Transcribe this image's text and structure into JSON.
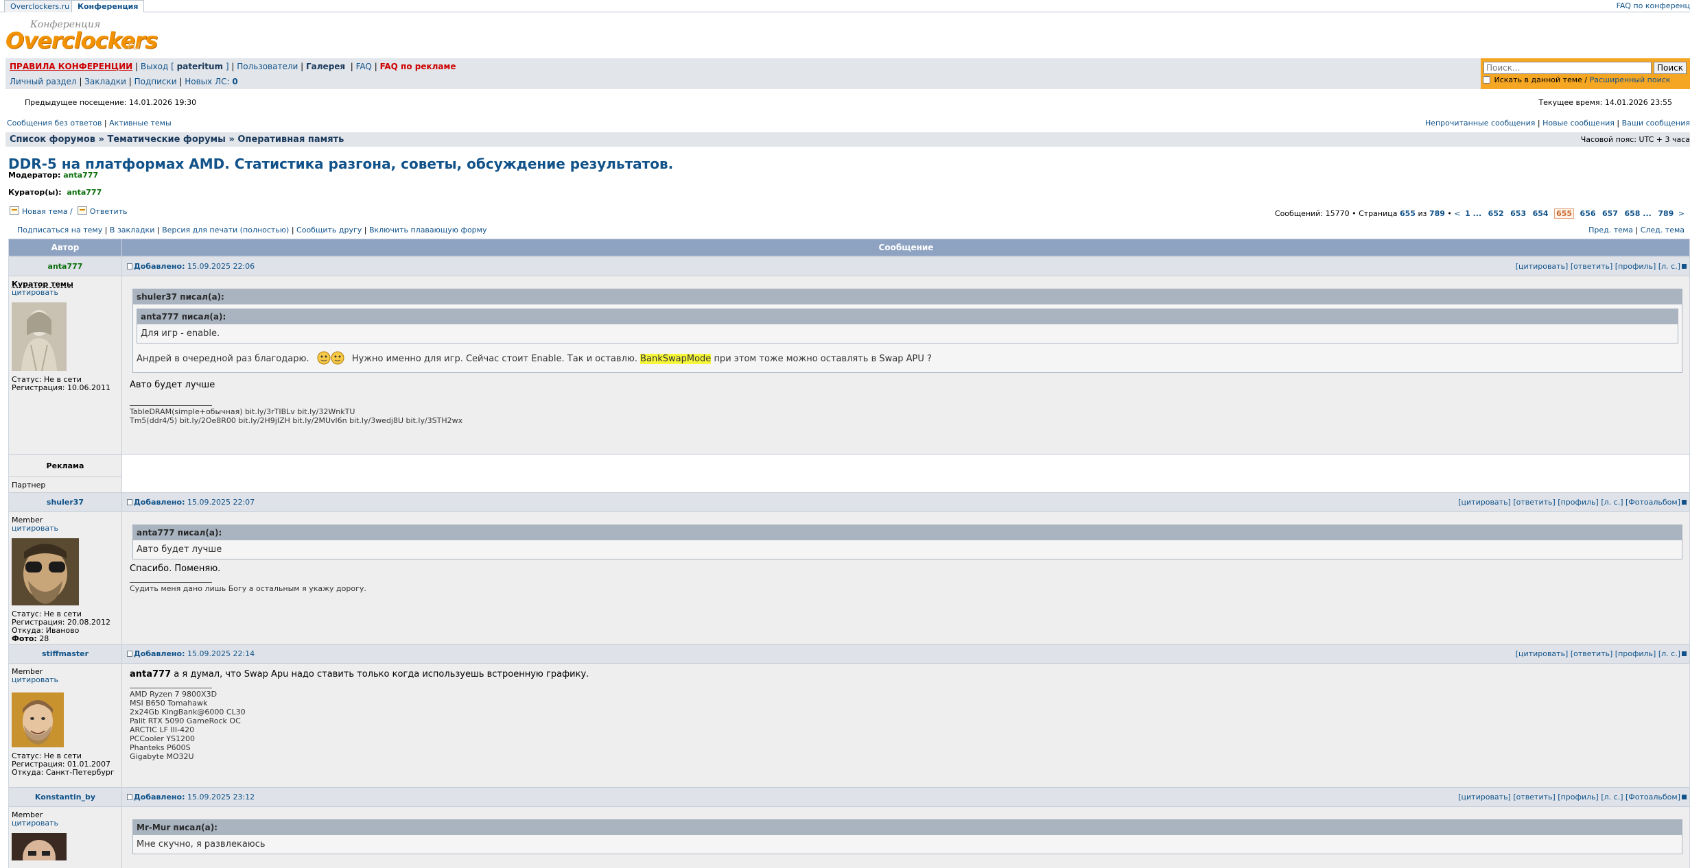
{
  "tabs": {
    "site": "Overclockers.ru",
    "conference": "Конференция",
    "faq_ads": "FAQ по конференц"
  },
  "logo": {
    "small": "Конференция",
    "big": "Overclockers",
    "ru": ".ru"
  },
  "nav": {
    "rules": "ПРАВИЛА КОНФЕРЕНЦИИ",
    "exit_prefix": "Выход [",
    "username": "pateritum",
    "exit_suffix": "]",
    "users": "Пользователи",
    "gallery": "Галерея",
    "faq": "FAQ",
    "faq_ads": "FAQ по рекламе",
    "personal": "Личный раздел",
    "bookmarks": "Закладки",
    "subscriptions": "Подписки",
    "new_pm_label": "Новых ЛС:",
    "new_pm_count": "0"
  },
  "search": {
    "placeholder": "Поиск...",
    "button": "Поиск",
    "in_topic": "Искать в данной теме /",
    "advanced": "Расширенный поиск"
  },
  "visit": {
    "previous": "Предыдущее посещение: 14.01.2026 19:30",
    "current": "Текущее время: 14.01.2026 23:55"
  },
  "links": {
    "no_answers": "Сообщения без ответов",
    "active": "Активные темы",
    "unread": "Непрочитанные сообщения",
    "new_msgs": "Новые сообщения",
    "yours": "Ваши сообщения"
  },
  "breadcrumb": {
    "forums": "Список форумов",
    "thematic": "Тематические форумы",
    "ram": "Оперативная память",
    "sep": "»",
    "timezone": "Часовой пояс: UTC + 3 часа"
  },
  "topic": {
    "title": "DDR-5 на платформах AMD. Статистика разгона, советы, обсуждение результатов.",
    "moderator_label": "Модератор:",
    "moderator": "anta777",
    "curator_label": "Куратор(ы):",
    "curator": "anta777"
  },
  "actions": {
    "new_topic": "Новая тема /",
    "reply": "Ответить",
    "subscribe": "Подписаться на тему",
    "bookmark": "В закладки",
    "print": "Версия для печати (полностью)",
    "tell": "Сообщить другу",
    "float": "Включить плавающую форму",
    "prev": "Пред. тема",
    "next": "След. тема"
  },
  "pagination": {
    "messages": "Сообщений: 15770 • Страница",
    "page": "655",
    "of": "из",
    "total": "789",
    "prev": "<",
    "first": "1 ...",
    "p652": "652",
    "p653": "653",
    "p654": "654",
    "current": "655",
    "p656": "656",
    "p657": "657",
    "p658": "658 ...",
    "last": "789",
    "next": ">"
  },
  "table": {
    "author_header": "Автор",
    "message_header": "Сообщение"
  },
  "post_links": {
    "quote": "[цитировать]",
    "answer": "[ответить]",
    "profile": "[профиль]",
    "pm": "[л. с.]",
    "album": "[Фотоальбом]",
    "added": "Добавлено:",
    "cite": "цитировать"
  },
  "posts": [
    {
      "author": "anta777",
      "date": "15.09.2025 22:06",
      "role": "Куратор темы",
      "status": "Статус: Не в сети",
      "reg": "Регистрация: 10.06.2011",
      "quote_outer_author": "shuler37 писал(а):",
      "quote_inner_author": "anta777 писал(а):",
      "quote_inner_text": "Для игр - enable.",
      "quote_outer_text_a": "Андрей в очередной раз благодарю.",
      "quote_outer_text_b": "Нужно именно для игр. Сейчас стоит Enable. Так и оставлю.",
      "quote_outer_hl": "BankSwapMode",
      "quote_outer_text_c": "при этом тоже можно оставлять в Swap APU ?",
      "text": "Авто будет лучше",
      "sig1": "TableDRAM(simple+обычная) bit.ly/3rTIBLv bit.ly/32WnkTU",
      "sig2": "Tm5(ddr4/5) bit.ly/2Oe8R00 bit.ly/2H9jIZH bit.ly/2MUvl6n bit.ly/3wedj8U bit.ly/3STH2wx"
    },
    {
      "author": "shuler37",
      "date": "15.09.2025 22:07",
      "role": "Member",
      "status": "Статус: Не в сети",
      "reg": "Регистрация: 20.08.2012",
      "from": "Откуда: Иваново",
      "photo_label": "Фото:",
      "photo_count": "28",
      "quote_author": "anta777 писал(а):",
      "quote_text": "Авто будет лучше",
      "text": "Спасибо. Поменяю.",
      "sig": "Судить меня дано лишь Богу а остальным я укажу дорогу."
    },
    {
      "author": "stiffmaster",
      "date": "15.09.2025 22:14",
      "role": "Member",
      "status": "Статус: Не в сети",
      "reg": "Регистрация: 01.01.2007",
      "from": "Откуда: Санкт-Петербург",
      "mention": "anta777",
      "text": "а я думал, что Swap Apu надо ставить только когда используешь встроенную графику.",
      "sig": [
        "AMD Ryzen 7 9800X3D",
        "MSI B650 Tomahawk",
        "2x24Gb KingBank@6000 CL30",
        "Palit RTX 5090 GameRock OC",
        "ARCTIC LF III-420",
        "PCCooler YS1200",
        "Phanteks P600S",
        "Gigabyte MO32U"
      ]
    },
    {
      "author": "Konstantin_by",
      "date": "15.09.2025 23:12",
      "role": "Member",
      "quote_author": "Mr-Mur писал(а):",
      "quote_text": "Мне скучно, я развлекаюсь"
    }
  ],
  "ad": {
    "label": "Реклама",
    "partner": "Партнер"
  }
}
